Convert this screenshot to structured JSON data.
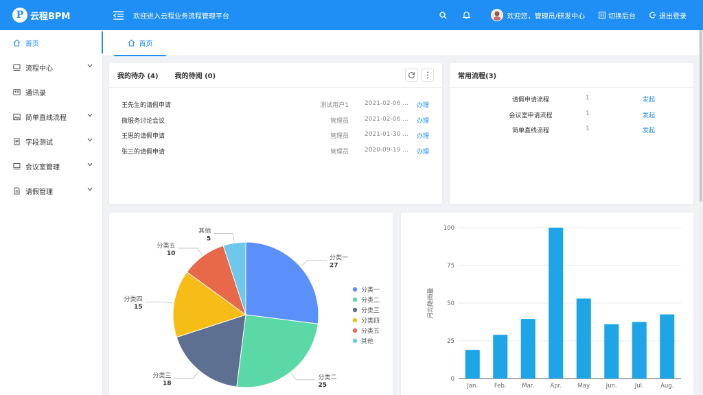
{
  "header": {
    "logo_glyph": "P",
    "logo_text": "云程BPM",
    "welcome": "欢迎进入云程业务流程管理平台",
    "user_greeting": "欢迎您，管理员/研发中心",
    "switch_label": "切换后台",
    "logout_label": "退出登录",
    "bg_color": "#1f8ef5"
  },
  "sidebar": {
    "items": [
      {
        "label": "首页",
        "icon": "home-icon"
      },
      {
        "label": "流程中心",
        "icon": "monitor-icon"
      },
      {
        "label": "通讯录",
        "icon": "contacts-icon"
      },
      {
        "label": "简单直线流程",
        "icon": "image-icon"
      },
      {
        "label": "字段测试",
        "icon": "document-icon"
      },
      {
        "label": "会议室管理",
        "icon": "monitor-icon"
      },
      {
        "label": "请假管理",
        "icon": "file-icon"
      }
    ]
  },
  "tabs": [
    {
      "label": "首页"
    }
  ],
  "todo": {
    "tab_pending": "我的待办 (4)",
    "tab_read": "我的待阅 (0)",
    "rows": [
      {
        "title": "王先生的请假申请",
        "user": "测试用户1",
        "date": "2021-02-06 ...",
        "action": "办理"
      },
      {
        "title": "微服务讨论会议",
        "user": "管理员",
        "date": "2021-02-06 ...",
        "action": "办理"
      },
      {
        "title": "王思的请假申请",
        "user": "管理员",
        "date": "2021-01-30 ...",
        "action": "办理"
      },
      {
        "title": "张三的请假申请",
        "user": "管理员",
        "date": "2020-09-19 ...",
        "action": "办理"
      }
    ]
  },
  "common_flows": {
    "title": "常用流程(3)",
    "rows": [
      {
        "name": "请假申请流程",
        "count": "1",
        "action": "发起"
      },
      {
        "name": "会议室申请流程",
        "count": "1",
        "action": "发起"
      },
      {
        "name": "简单直线流程",
        "count": "1",
        "action": "发起"
      }
    ]
  },
  "chart_data": [
    {
      "type": "pie",
      "categories": [
        "分类一",
        "分类二",
        "分类三",
        "分类四",
        "分类五",
        "其他"
      ],
      "values": [
        27,
        25,
        18,
        15,
        10,
        5
      ],
      "colors": [
        "#5b8ff9",
        "#5ad8a6",
        "#5d7092",
        "#f6bd16",
        "#e8684a",
        "#6dc8ec"
      ],
      "legend_position": "right"
    },
    {
      "type": "bar",
      "categories": [
        "Jan.",
        "Feb.",
        "Mar.",
        "Apr.",
        "May",
        "Jun.",
        "Jul.",
        "Aug."
      ],
      "values": [
        19,
        29,
        39.5,
        100,
        53,
        36,
        37.5,
        42.5
      ],
      "ylabel": "月均降雨量",
      "ylim": [
        0,
        100
      ],
      "yticks": [
        0,
        25,
        50,
        75,
        100
      ],
      "grid": true,
      "color": "#1da5e7"
    }
  ]
}
